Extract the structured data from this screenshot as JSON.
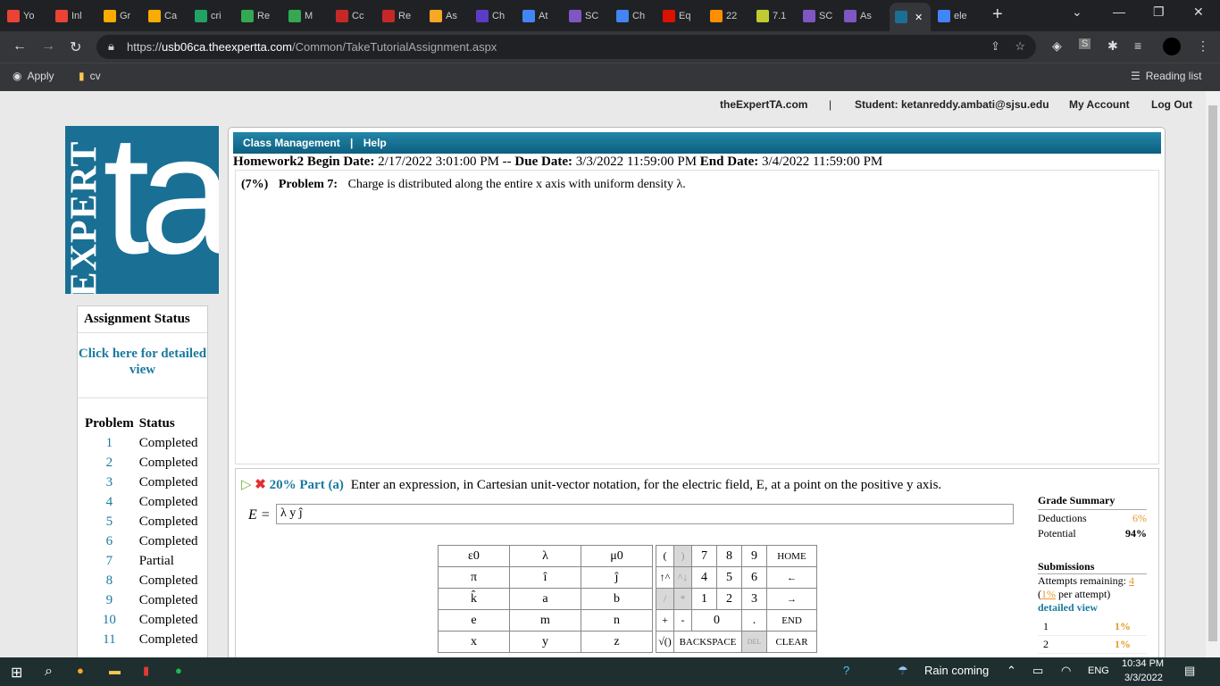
{
  "tabs": [
    {
      "label": "Yo",
      "icon": "gmail-icon",
      "color": "#ea4335"
    },
    {
      "label": "Inl",
      "icon": "gmail-icon",
      "color": "#ea4335"
    },
    {
      "label": "Gr",
      "icon": "loading-icon",
      "color": "#f9ab00"
    },
    {
      "label": "Ca",
      "icon": "loading-icon",
      "color": "#f9ab00"
    },
    {
      "label": "cri",
      "icon": "cross-icon",
      "color": "#21a366"
    },
    {
      "label": "Re",
      "icon": "drive-icon",
      "color": "#34a853"
    },
    {
      "label": "M",
      "icon": "drive-icon",
      "color": "#34a853"
    },
    {
      "label": "Cc",
      "icon": "m-icon",
      "color": "#c62828"
    },
    {
      "label": "Re",
      "icon": "mcgraw-icon",
      "color": "#c62828"
    },
    {
      "label": "As",
      "icon": "home-icon",
      "color": "#f9a825"
    },
    {
      "label": "Ch",
      "icon": "s-icon",
      "color": "#5b3cc4"
    },
    {
      "label": "At",
      "icon": "google-icon",
      "color": "#4285f4"
    },
    {
      "label": "SC",
      "icon": "play-icon",
      "color": "#7e57c2"
    },
    {
      "label": "Ch",
      "icon": "google-icon",
      "color": "#4285f4"
    },
    {
      "label": "Eq",
      "icon": "wolfram-icon",
      "color": "#dd1100"
    },
    {
      "label": "22",
      "icon": "sun-icon",
      "color": "#ff8f00"
    },
    {
      "label": "7.1",
      "icon": "lines-icon",
      "color": "#c0ca33"
    },
    {
      "label": "SC",
      "icon": "play-icon",
      "color": "#7e57c2"
    },
    {
      "label": "As",
      "icon": "play-icon",
      "color": "#7e57c2"
    },
    {
      "label": "",
      "icon": "ta-icon",
      "color": "#1a6f94",
      "active": true
    },
    {
      "label": "ele",
      "icon": "google-icon",
      "color": "#4285f4"
    }
  ],
  "url": {
    "domain": "usb06ca.theexpertta.com",
    "path": "/Common/TakeTutorialAssignment.aspx",
    "prefix": "https://"
  },
  "bookmarks": [
    {
      "label": "Apply",
      "icon": "globe-icon"
    },
    {
      "label": "cv",
      "icon": "folder-icon"
    }
  ],
  "reading_list": "Reading list",
  "toplinks": {
    "site": "theExpertTA.com",
    "sep": "|",
    "student": "Student: ketanreddy.ambati@sjsu.edu",
    "account": "My Account",
    "logout": "Log Out"
  },
  "logo": {
    "vertical": "EXPERT",
    "big": "ta"
  },
  "status": {
    "title": "Assignment Status",
    "detail_link": "Click here for detailed view",
    "col_problem": "Problem",
    "col_status": "Status",
    "rows": [
      {
        "n": "1",
        "s": "Completed"
      },
      {
        "n": "2",
        "s": "Completed"
      },
      {
        "n": "3",
        "s": "Completed"
      },
      {
        "n": "4",
        "s": "Completed"
      },
      {
        "n": "5",
        "s": "Completed"
      },
      {
        "n": "6",
        "s": "Completed"
      },
      {
        "n": "7",
        "s": "Partial"
      },
      {
        "n": "8",
        "s": "Completed"
      },
      {
        "n": "9",
        "s": "Completed"
      },
      {
        "n": "10",
        "s": "Completed"
      },
      {
        "n": "11",
        "s": "Completed"
      }
    ]
  },
  "mainbar": {
    "class_mgmt": "Class Management",
    "sep": "|",
    "help": "Help"
  },
  "homework": {
    "name": "Homework2",
    "begin_label": "Begin Date:",
    "begin": "2/17/2022 3:01:00 PM",
    "dash": "--",
    "due_label": "Due Date:",
    "due": "3/3/2022 11:59:00 PM",
    "end_label": "End Date:",
    "end": "3/4/2022 11:59:00 PM"
  },
  "problem": {
    "weight": "(7%)",
    "label": "Problem 7:",
    "text": "Charge is distributed along the entire x axis with uniform density λ."
  },
  "part": {
    "pct": "20% Part (a)",
    "question": "Enter an expression, in Cartesian unit-vector notation, for the electric field, E, at a point on the positive y axis.",
    "answer_label": "E =",
    "answer": "λ y ĵ"
  },
  "keypad": {
    "row1": [
      "ε0",
      "λ",
      "μ0",
      "(",
      ")",
      "7",
      "8",
      "9",
      "HOME"
    ],
    "row2": [
      "π",
      "î",
      "ĵ",
      "↑^",
      "^↓",
      "4",
      "5",
      "6",
      "←"
    ],
    "row3": [
      "k̂",
      "a",
      "b",
      "/",
      "*",
      "1",
      "2",
      "3",
      "→"
    ],
    "row4": [
      "e",
      "m",
      "n",
      "+",
      "-",
      "0",
      ".",
      "END"
    ],
    "row5": [
      "x",
      "y",
      "z",
      "√()",
      "BACKSPACE",
      "DEL",
      "CLEAR"
    ]
  },
  "grade": {
    "title": "Grade Summary",
    "deductions_label": "Deductions",
    "deductions": "6%",
    "potential_label": "Potential",
    "potential": "94%",
    "submissions": "Submissions",
    "attempts_label": "Attempts remaining:",
    "attempts": "4",
    "per_attempt_pct": "1%",
    "per_attempt": "per attempt)",
    "detail": "detailed view",
    "list": [
      {
        "n": "1",
        "p": "1%"
      },
      {
        "n": "2",
        "p": "1%"
      }
    ]
  },
  "taskbar": {
    "weather": "Rain coming",
    "lang": "ENG",
    "time": "10:34 PM",
    "date": "3/3/2022"
  }
}
